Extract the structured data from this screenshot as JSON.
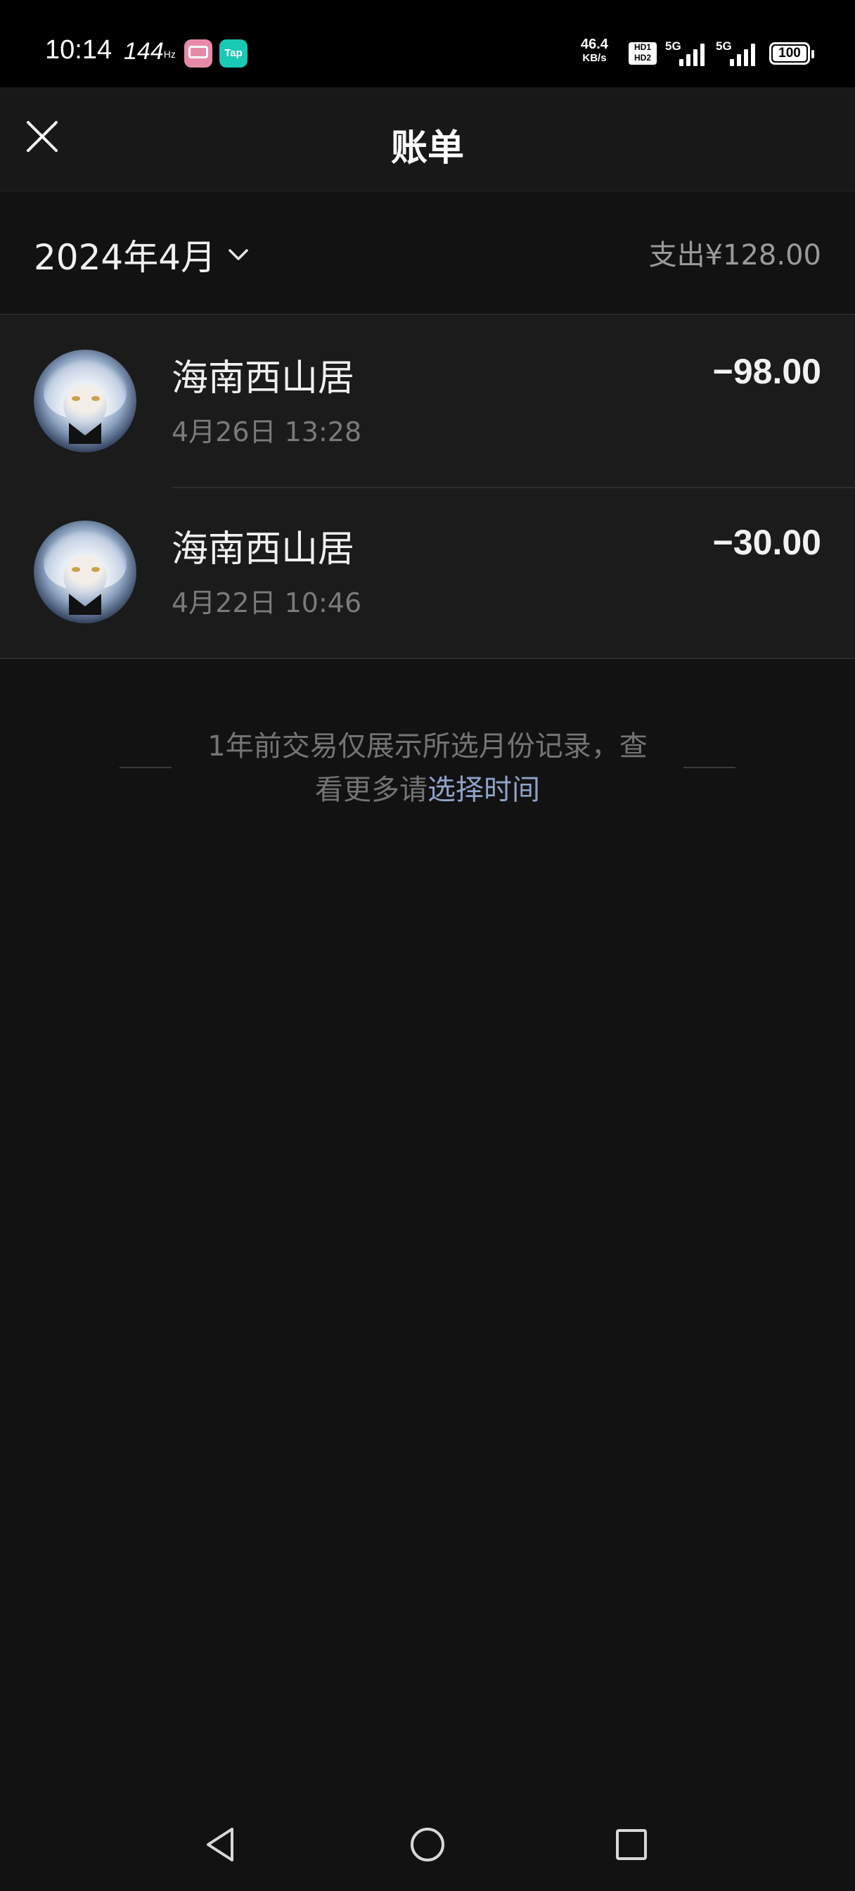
{
  "status_bar": {
    "time": "10:14",
    "refresh_rate": "144",
    "refresh_unit": "Hz",
    "tap_app_label": "Tap",
    "net_speed": "46.4",
    "net_speed_unit": "KB/s",
    "hd1": "HD1",
    "hd2": "HD2",
    "sim1": "5G",
    "sim2": "5G",
    "battery": "100"
  },
  "header": {
    "title": "账单"
  },
  "month_bar": {
    "month": "2024年4月",
    "summary_label": "支出",
    "summary_amount": "¥128.00"
  },
  "transactions": [
    {
      "merchant": "海南西山居",
      "time": "4月26日 13:28",
      "amount": "−98.00"
    },
    {
      "merchant": "海南西山居",
      "time": "4月22日 10:46",
      "amount": "−30.00"
    }
  ],
  "notice": {
    "line1": "1年前交易仅展示所选月份记录，查",
    "line2_prefix": "看更多请",
    "link": "选择时间"
  },
  "colors": {
    "background": "#121212",
    "list_background": "#1b1b1b",
    "link": "#8fa3c8"
  }
}
